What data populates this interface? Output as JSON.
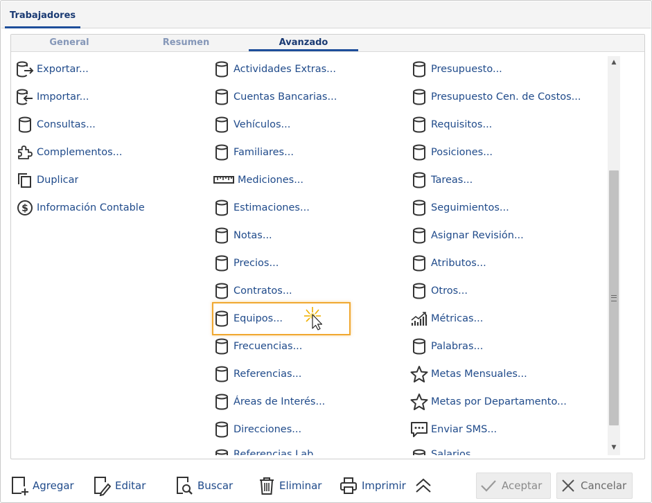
{
  "window": {
    "title": "Trabajadores"
  },
  "tabs": [
    {
      "label": "General",
      "active": false
    },
    {
      "label": "Resumen",
      "active": false
    },
    {
      "label": "Avanzado",
      "active": true
    }
  ],
  "columns": [
    {
      "items": [
        {
          "label": "Exportar...",
          "icon": "export-database-icon"
        },
        {
          "label": "Importar...",
          "icon": "import-database-icon"
        },
        {
          "label": "Consultas...",
          "icon": "database-icon"
        },
        {
          "label": "Complementos...",
          "icon": "puzzle-icon"
        },
        {
          "label": "Duplicar",
          "icon": "copy-icon"
        },
        {
          "label": "Información Contable",
          "icon": "dollar-circle-icon"
        }
      ]
    },
    {
      "items": [
        {
          "label": "Actividades Extras...",
          "icon": "database-icon"
        },
        {
          "label": "Cuentas Bancarias...",
          "icon": "database-icon"
        },
        {
          "label": "Vehículos...",
          "icon": "database-icon"
        },
        {
          "label": "Familiares...",
          "icon": "database-icon"
        },
        {
          "label": "Mediciones...",
          "icon": "ruler-icon"
        },
        {
          "label": "Estimaciones...",
          "icon": "database-icon"
        },
        {
          "label": "Notas...",
          "icon": "database-icon"
        },
        {
          "label": "Precios...",
          "icon": "database-icon"
        },
        {
          "label": "Contratos...",
          "icon": "database-icon"
        },
        {
          "label": "Equipos...",
          "icon": "database-icon"
        },
        {
          "label": "Frecuencias...",
          "icon": "database-icon"
        },
        {
          "label": "Referencias...",
          "icon": "database-icon"
        },
        {
          "label": "Áreas de Interés...",
          "icon": "database-icon"
        },
        {
          "label": "Direcciones...",
          "icon": "database-icon"
        },
        {
          "label": "Referencias Lab...",
          "icon": "database-icon"
        }
      ]
    },
    {
      "items": [
        {
          "label": "Presupuesto...",
          "icon": "database-icon"
        },
        {
          "label": "Presupuesto Cen. de Costos...",
          "icon": "database-icon"
        },
        {
          "label": "Requisitos...",
          "icon": "database-icon"
        },
        {
          "label": "Posiciones...",
          "icon": "database-icon"
        },
        {
          "label": "Tareas...",
          "icon": "database-icon"
        },
        {
          "label": "Seguimientos...",
          "icon": "database-icon"
        },
        {
          "label": "Asignar Revisión...",
          "icon": "database-icon"
        },
        {
          "label": "Atributos...",
          "icon": "database-icon"
        },
        {
          "label": "Otros...",
          "icon": "database-icon"
        },
        {
          "label": "Métricas...",
          "icon": "chart-trend-icon"
        },
        {
          "label": "Palabras...",
          "icon": "database-icon"
        },
        {
          "label": "Metas Mensuales...",
          "icon": "star-icon"
        },
        {
          "label": "Metas por Departamento...",
          "icon": "star-icon"
        },
        {
          "label": "Enviar SMS...",
          "icon": "message-icon"
        },
        {
          "label": "Salarios...",
          "icon": "database-icon"
        }
      ]
    }
  ],
  "toolbar": {
    "add": "Agregar",
    "edit": "Editar",
    "search": "Buscar",
    "delete": "Eliminar",
    "print": "Imprimir",
    "accept": "Aceptar",
    "cancel": "Cancelar"
  },
  "colors": {
    "accent": "#1d4e9a",
    "link": "#1f4a8a",
    "highlight": "#f0a830"
  }
}
